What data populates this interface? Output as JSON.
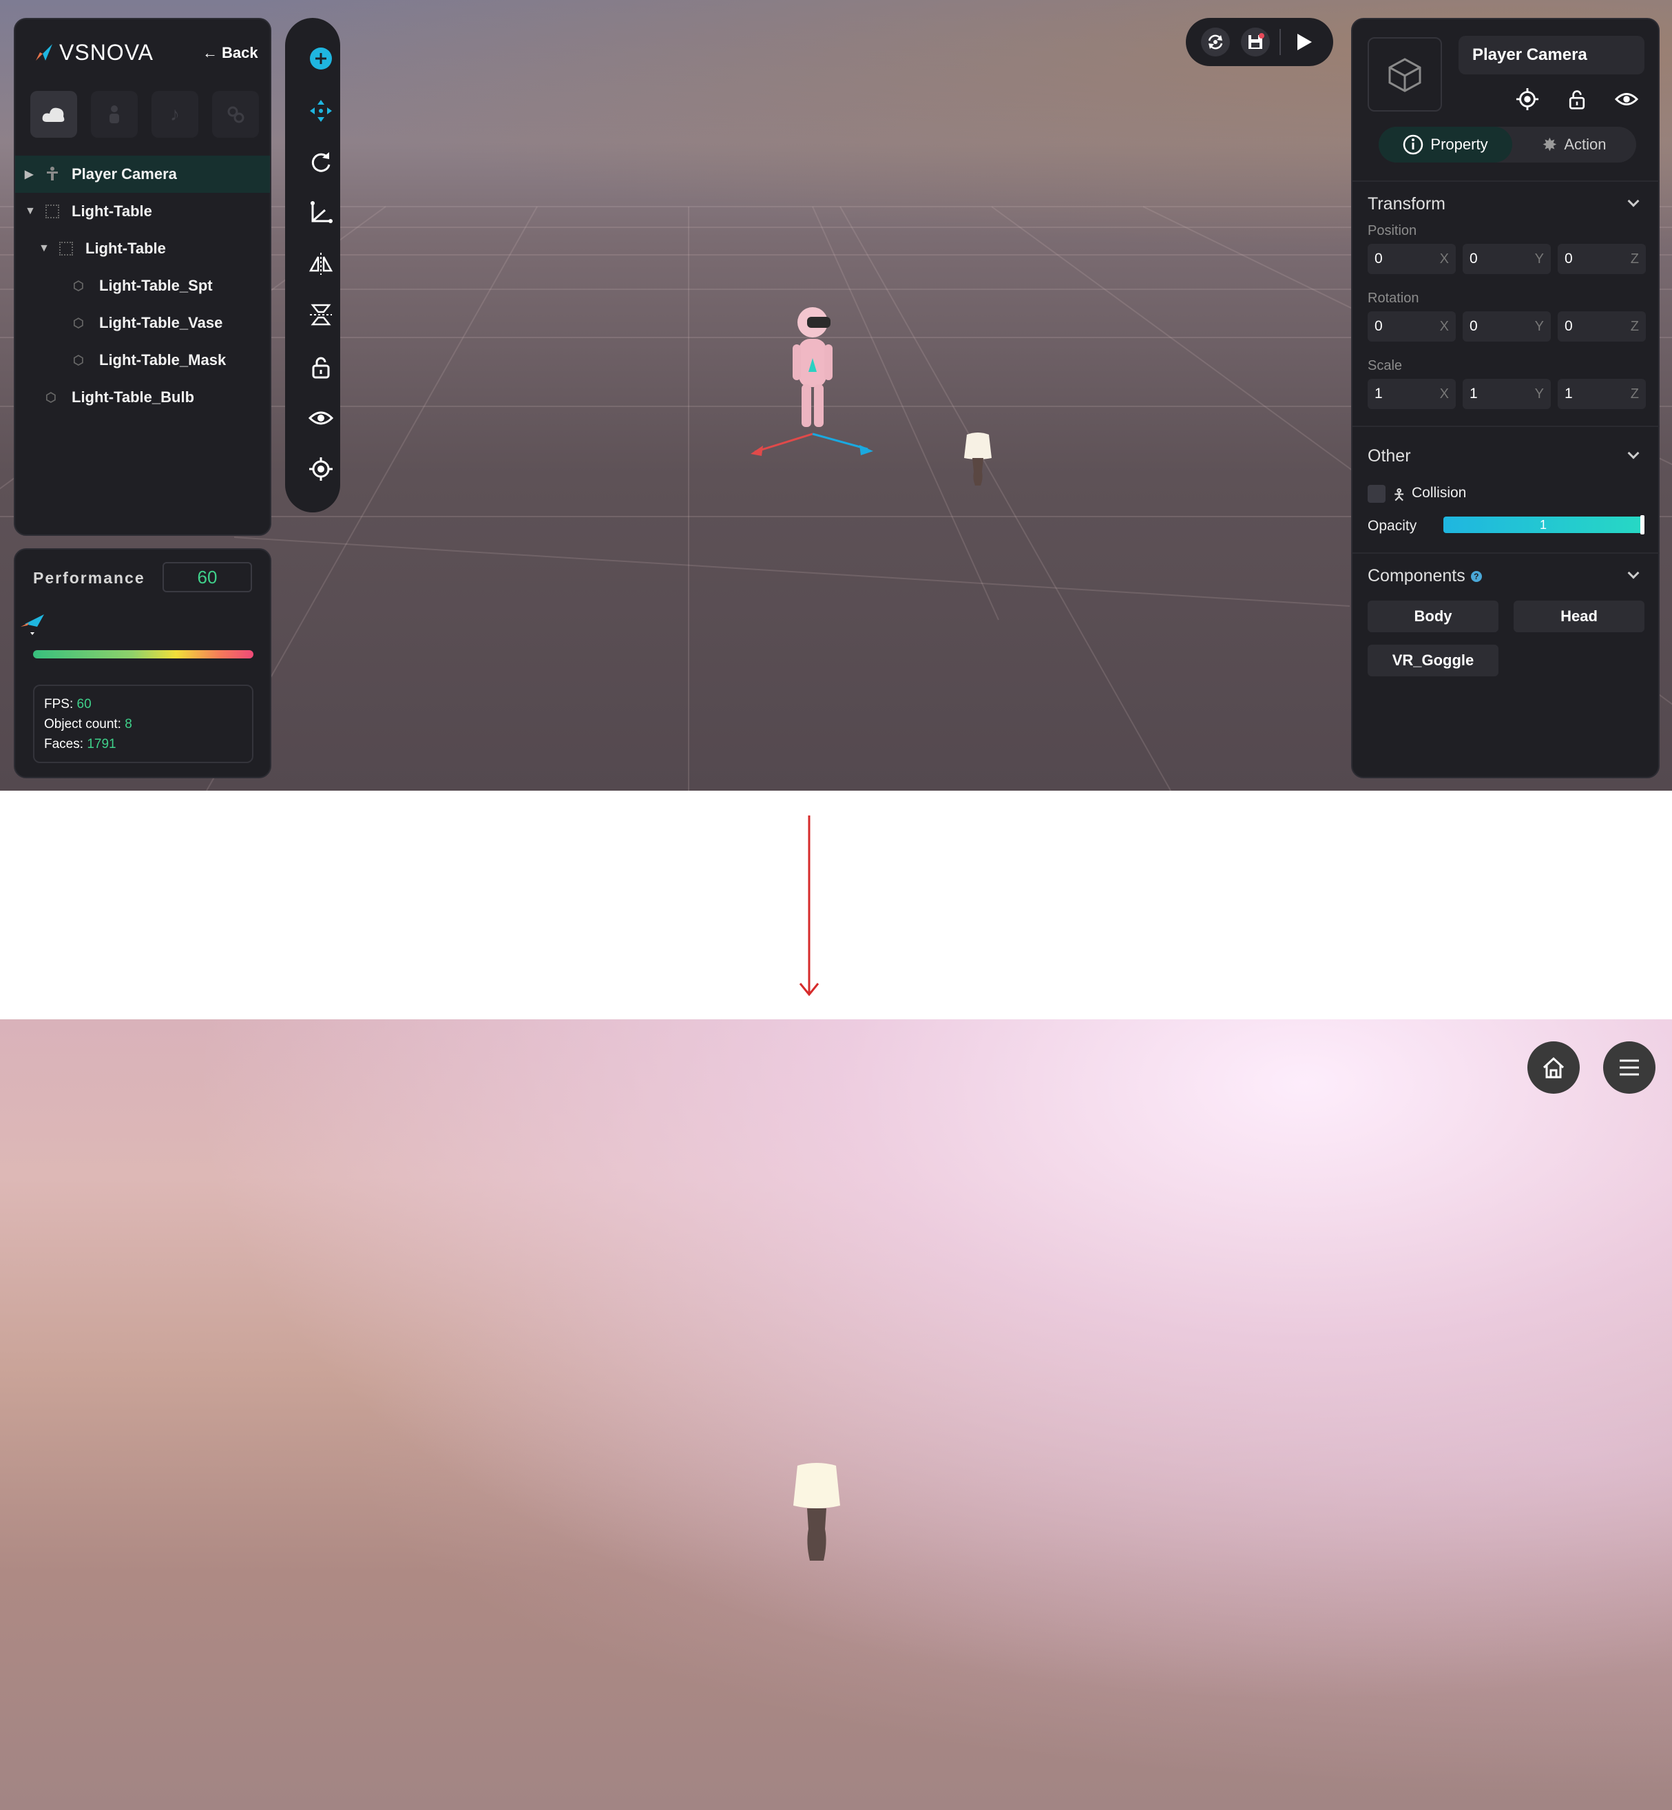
{
  "app": {
    "brand": "VSNOVA",
    "back_label": "Back"
  },
  "hierarchy": {
    "items": [
      {
        "label": "Player Camera",
        "selected": true,
        "expander": "collapsed",
        "icon": "person-icon"
      },
      {
        "label": "Light-Table",
        "expander": "expanded",
        "icon": "group-icon"
      },
      {
        "label": "Light-Table",
        "expander": "expanded",
        "icon": "group-icon"
      },
      {
        "label": "Light-Table_Spt",
        "icon": "mesh-icon"
      },
      {
        "label": "Light-Table_Vase",
        "icon": "mesh-icon"
      },
      {
        "label": "Light-Table_Mask",
        "icon": "mesh-icon"
      },
      {
        "label": "Light-Table_Bulb",
        "icon": "mesh-icon"
      }
    ]
  },
  "performance": {
    "label": "Performance",
    "value": "60",
    "fps_label": "FPS:",
    "fps": "60",
    "objects_label": "Object count:",
    "objects": "8",
    "faces_label": "Faces:",
    "faces": "1791"
  },
  "inspector": {
    "object_name": "Player Camera",
    "tabs": {
      "property": "Property",
      "action": "Action",
      "active": "property"
    },
    "transform": {
      "title": "Transform",
      "position_label": "Position",
      "position": [
        "0",
        "0",
        "0"
      ],
      "rotation_label": "Rotation",
      "rotation": [
        "0",
        "0",
        "0"
      ],
      "scale_label": "Scale",
      "scale": [
        "1",
        "1",
        "1"
      ],
      "axes": [
        "X",
        "Y",
        "Z"
      ]
    },
    "other": {
      "title": "Other",
      "collision_label": "Collision",
      "collision": false,
      "opacity_label": "Opacity",
      "opacity": "1"
    },
    "components": {
      "title": "Components",
      "items": [
        "Body",
        "Head",
        "VR_Goggle"
      ]
    }
  },
  "colors": {
    "accent": "#1fb6e0",
    "highlight": "#17302f",
    "good": "#3fd08a"
  }
}
